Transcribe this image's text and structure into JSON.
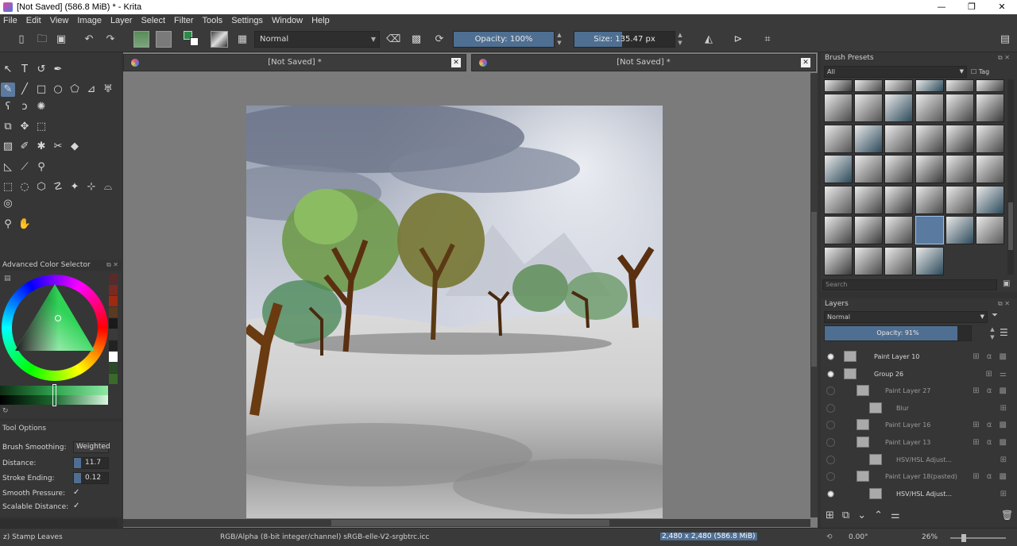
{
  "window": {
    "title": "[Not Saved]  (586.8 MiB)  * - Krita",
    "minimize_label": "—",
    "maximize_label": "❐",
    "close_label": "✕"
  },
  "menu": [
    "File",
    "Edit",
    "View",
    "Image",
    "Layer",
    "Select",
    "Filter",
    "Tools",
    "Settings",
    "Window",
    "Help"
  ],
  "toolbar": {
    "blend_mode": "Normal",
    "opacity_label": "Opacity: 100%",
    "opacity_value": 1.0,
    "size_label": "Size: 135.47 px",
    "size_fraction": 0.48
  },
  "tabs": [
    {
      "label": "[Not Saved]  *",
      "close": "✕"
    },
    {
      "label": "[Not Saved]  *",
      "close": "✕"
    }
  ],
  "panels": {
    "color_selector_title": "Advanced Color Selector",
    "tool_options_title": "Tool Options",
    "brush_presets_title": "Brush Presets",
    "brush_filter": "All",
    "tag_label": "Tag",
    "search_placeholder": "Search",
    "layers_title": "Layers",
    "layers_blend": "Normal",
    "layers_opacity": "Opacity:  91%",
    "layers_opacity_value": 0.91
  },
  "tool_options": {
    "smoothing_label": "Brush Smoothing:",
    "smoothing_value": "Weighted",
    "distance_label": "Distance:",
    "distance_value": "11.7",
    "stroke_ending_label": "Stroke Ending:",
    "stroke_ending_value": "0.12",
    "smooth_pressure_label": "Smooth Pressure:",
    "scalable_distance_label": "Scalable Distance:",
    "check_mark": "✓"
  },
  "layers": [
    {
      "name": "Paint Layer 10",
      "visible": true
    },
    {
      "name": "Group 26",
      "visible": true
    },
    {
      "name": "Paint Layer 27",
      "visible": false
    },
    {
      "name": "Blur",
      "visible": false
    },
    {
      "name": "Paint Layer 16",
      "visible": false
    },
    {
      "name": "Paint Layer 13",
      "visible": false
    },
    {
      "name": "HSV/HSL Adjust...",
      "visible": false
    },
    {
      "name": "Paint Layer 18(pasted)",
      "visible": false
    },
    {
      "name": "HSV/HSL Adjust...",
      "visible": true
    }
  ],
  "status": {
    "brush": "z) Stamp Leaves",
    "colorspace": "RGB/Alpha (8-bit integer/channel)  sRGB-elle-V2-srgbtrc.icc",
    "dimensions": "2,480 x 2,480 (586.8 MiB)",
    "rotation": "0.00°",
    "zoom": "26%"
  },
  "colors": {
    "accent": "#5b7aa0",
    "panel": "#363636",
    "canvas_bg": "#7b7b7b"
  }
}
